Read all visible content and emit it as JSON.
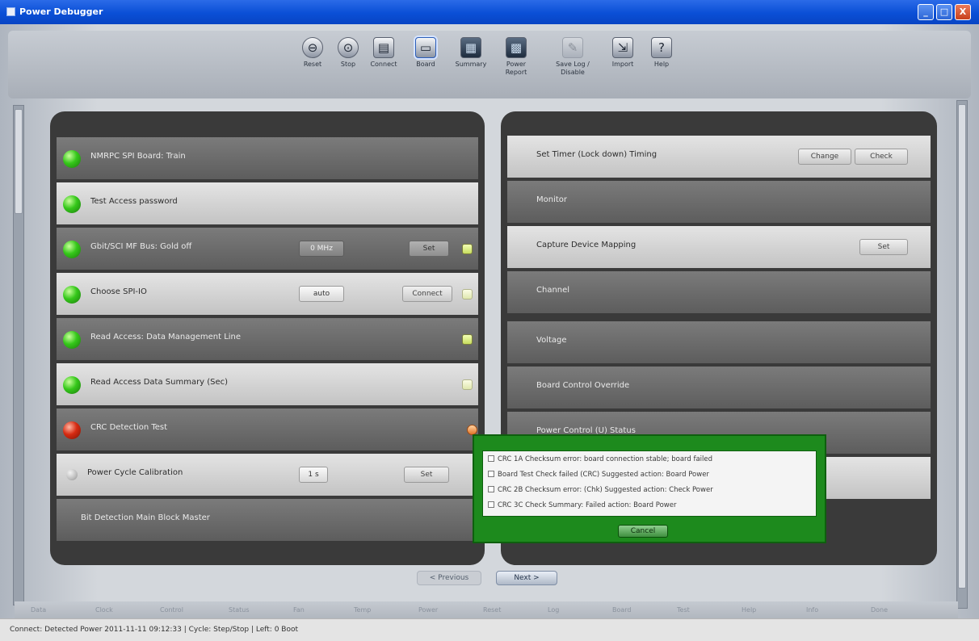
{
  "window": {
    "title": "Power Debugger",
    "controls": [
      "_",
      "□",
      "X"
    ]
  },
  "toolbar": {
    "tools": [
      {
        "label": "Reset",
        "icon": "reset-icon"
      },
      {
        "label": "Stop",
        "icon": "stop-icon"
      },
      {
        "label": "Connect",
        "icon": "connect-icon"
      },
      {
        "label": "Board",
        "icon": "board-icon"
      },
      {
        "label": "Summary",
        "icon": "summary-icon"
      },
      {
        "label": "Power Report",
        "icon": "report-icon"
      },
      {
        "label": "Save Log / Disable",
        "icon": "disabled-tool-icon"
      },
      {
        "label": "Import",
        "icon": "import-icon"
      },
      {
        "label": "Help",
        "icon": "help-icon"
      }
    ]
  },
  "left_panel": {
    "rows": [
      {
        "text": "NMRPC SPI Board: Train",
        "style": "dark",
        "status": "green"
      },
      {
        "text": "Test Access password",
        "style": "light",
        "status": "green"
      },
      {
        "text": "Gbit/SCI MF Bus: Gold off",
        "style": "dark",
        "status": "green",
        "field": "0 MHz",
        "button": "Set",
        "indicator": "lime"
      },
      {
        "text": "Choose SPI-IO",
        "style": "light",
        "status": "green",
        "field": "auto",
        "button": "Connect",
        "indicator": "pale"
      },
      {
        "text": "Read Access: Data Management Line",
        "style": "dark",
        "status": "green",
        "indicator": "lime"
      },
      {
        "text": "Read Access Data Summary (Sec)",
        "style": "light",
        "status": "green",
        "indicator": "pale"
      },
      {
        "text": "CRC Detection Test",
        "style": "dark",
        "status": "red",
        "indicator": "orange"
      },
      {
        "text": "Power Cycle Calibration",
        "style": "light",
        "status": "off",
        "field": "1 s",
        "button": "Set"
      },
      {
        "text": "Bit Detection Main Block Master",
        "style": "dark",
        "status": "none"
      }
    ]
  },
  "right_panel": {
    "rows": [
      {
        "text": "Set Timer (Lock down) Timing",
        "style": "light",
        "buttons": [
          "Change",
          "Check"
        ]
      },
      {
        "text": "Monitor",
        "style": "dark"
      },
      {
        "text": "Capture Device Mapping",
        "style": "light",
        "buttons": [
          "Set"
        ]
      },
      {
        "text": "Channel",
        "style": "dark"
      },
      {
        "text": "Voltage",
        "style": "dark"
      },
      {
        "text": "Board Control Override",
        "style": "dark"
      },
      {
        "text": "Power Control (U) Status",
        "style": "dark"
      },
      {
        "text": "",
        "style": "light"
      }
    ]
  },
  "popup": {
    "lines": [
      "CRC 1A Checksum error: board connection stable; board failed",
      "Board Test Check failed (CRC) Suggested action: Board Power",
      "CRC 2B Checksum error: (Chk) Suggested action: Check Power",
      "CRC 3C Check Summary: Failed action: Board Power"
    ],
    "button": "Cancel"
  },
  "pager": {
    "prev": "< Previous",
    "next": "Next >"
  },
  "bottom_strip": [
    "Data",
    "Clock",
    "Control",
    "Status",
    "Fan",
    "Temp",
    "Power",
    "Reset",
    "Log",
    "Board",
    "Test",
    "Help",
    "Info",
    "Done"
  ],
  "status_bar": {
    "text": "Connect: Detected Power 2011-11-11 09:12:33 | Cycle: Step/Stop | Left: 0 Boot"
  }
}
